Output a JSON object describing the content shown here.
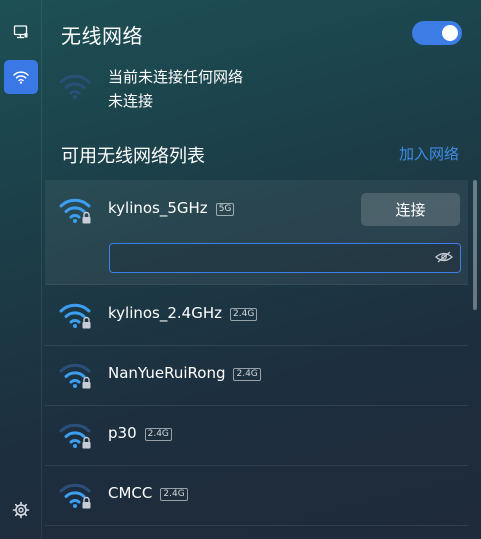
{
  "rail": {
    "items": [
      {
        "icon": "wired-network-icon",
        "active": false
      },
      {
        "icon": "wifi-icon",
        "active": true
      }
    ],
    "settings_icon": "gear-icon"
  },
  "header": {
    "title": "无线网络",
    "toggle_on": true
  },
  "current": {
    "status": "当前未连接任何网络",
    "substatus": "未连接"
  },
  "available": {
    "title": "可用无线网络列表",
    "join_label": "加入网络"
  },
  "networks": [
    {
      "ssid": "kylinos_5GHz",
      "band": "5G",
      "strength": "strong",
      "secured": true,
      "expanded": true,
      "connect_label": "连接",
      "password_value": "",
      "password_placeholder": ""
    },
    {
      "ssid": "kylinos_2.4GHz",
      "band": "2.4G",
      "strength": "strong",
      "secured": true
    },
    {
      "ssid": "NanYueRuiRong",
      "band": "2.4G",
      "strength": "medium",
      "secured": true
    },
    {
      "ssid": "p30",
      "band": "2.4G",
      "strength": "medium",
      "secured": true
    },
    {
      "ssid": "CMCC",
      "band": "2.4G",
      "strength": "medium",
      "secured": true
    }
  ],
  "colors": {
    "accent": "#3a78e6",
    "link": "#3f8ce8",
    "wifi_strong": "#3b9ef0",
    "wifi_weak": "#2a4f78"
  }
}
